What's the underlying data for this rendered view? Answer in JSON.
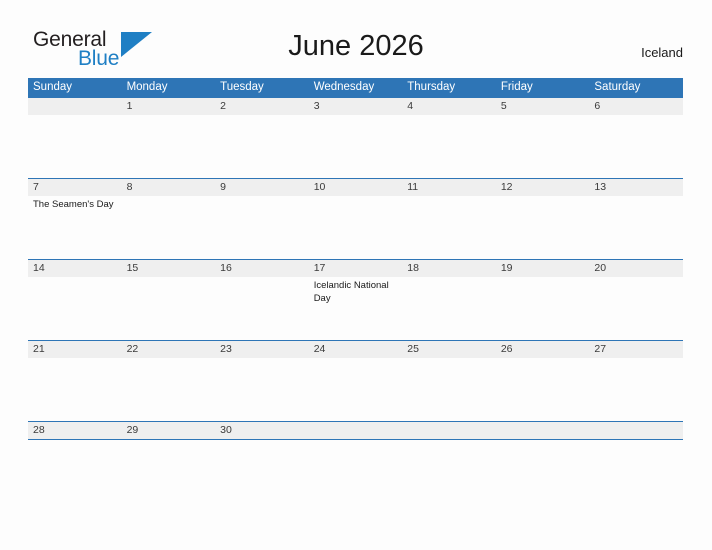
{
  "brand": {
    "name_part1": "General",
    "name_part2": "Blue",
    "mark": "triangle-logo-icon",
    "accent_color": "#1f7fc4"
  },
  "header": {
    "title": "June 2026",
    "location": "Iceland"
  },
  "theme": {
    "header_blue": "#2e75b6",
    "date_band": "#efefef",
    "page_background": "#fdfdfd",
    "text": "#1a1a1a"
  },
  "calendar": {
    "day_names": [
      "Sunday",
      "Monday",
      "Tuesday",
      "Wednesday",
      "Thursday",
      "Friday",
      "Saturday"
    ],
    "weeks": [
      {
        "days": [
          {
            "date": "",
            "event": ""
          },
          {
            "date": "1",
            "event": ""
          },
          {
            "date": "2",
            "event": ""
          },
          {
            "date": "3",
            "event": ""
          },
          {
            "date": "4",
            "event": ""
          },
          {
            "date": "5",
            "event": ""
          },
          {
            "date": "6",
            "event": ""
          }
        ]
      },
      {
        "days": [
          {
            "date": "7",
            "event": "The Seamen's Day"
          },
          {
            "date": "8",
            "event": ""
          },
          {
            "date": "9",
            "event": ""
          },
          {
            "date": "10",
            "event": ""
          },
          {
            "date": "11",
            "event": ""
          },
          {
            "date": "12",
            "event": ""
          },
          {
            "date": "13",
            "event": ""
          }
        ]
      },
      {
        "days": [
          {
            "date": "14",
            "event": ""
          },
          {
            "date": "15",
            "event": ""
          },
          {
            "date": "16",
            "event": ""
          },
          {
            "date": "17",
            "event": "Icelandic National Day"
          },
          {
            "date": "18",
            "event": ""
          },
          {
            "date": "19",
            "event": ""
          },
          {
            "date": "20",
            "event": ""
          }
        ]
      },
      {
        "days": [
          {
            "date": "21",
            "event": ""
          },
          {
            "date": "22",
            "event": ""
          },
          {
            "date": "23",
            "event": ""
          },
          {
            "date": "24",
            "event": ""
          },
          {
            "date": "25",
            "event": ""
          },
          {
            "date": "26",
            "event": ""
          },
          {
            "date": "27",
            "event": ""
          }
        ]
      },
      {
        "days": [
          {
            "date": "28",
            "event": ""
          },
          {
            "date": "29",
            "event": ""
          },
          {
            "date": "30",
            "event": ""
          },
          {
            "date": "",
            "event": ""
          },
          {
            "date": "",
            "event": ""
          },
          {
            "date": "",
            "event": ""
          },
          {
            "date": "",
            "event": ""
          }
        ]
      }
    ]
  }
}
